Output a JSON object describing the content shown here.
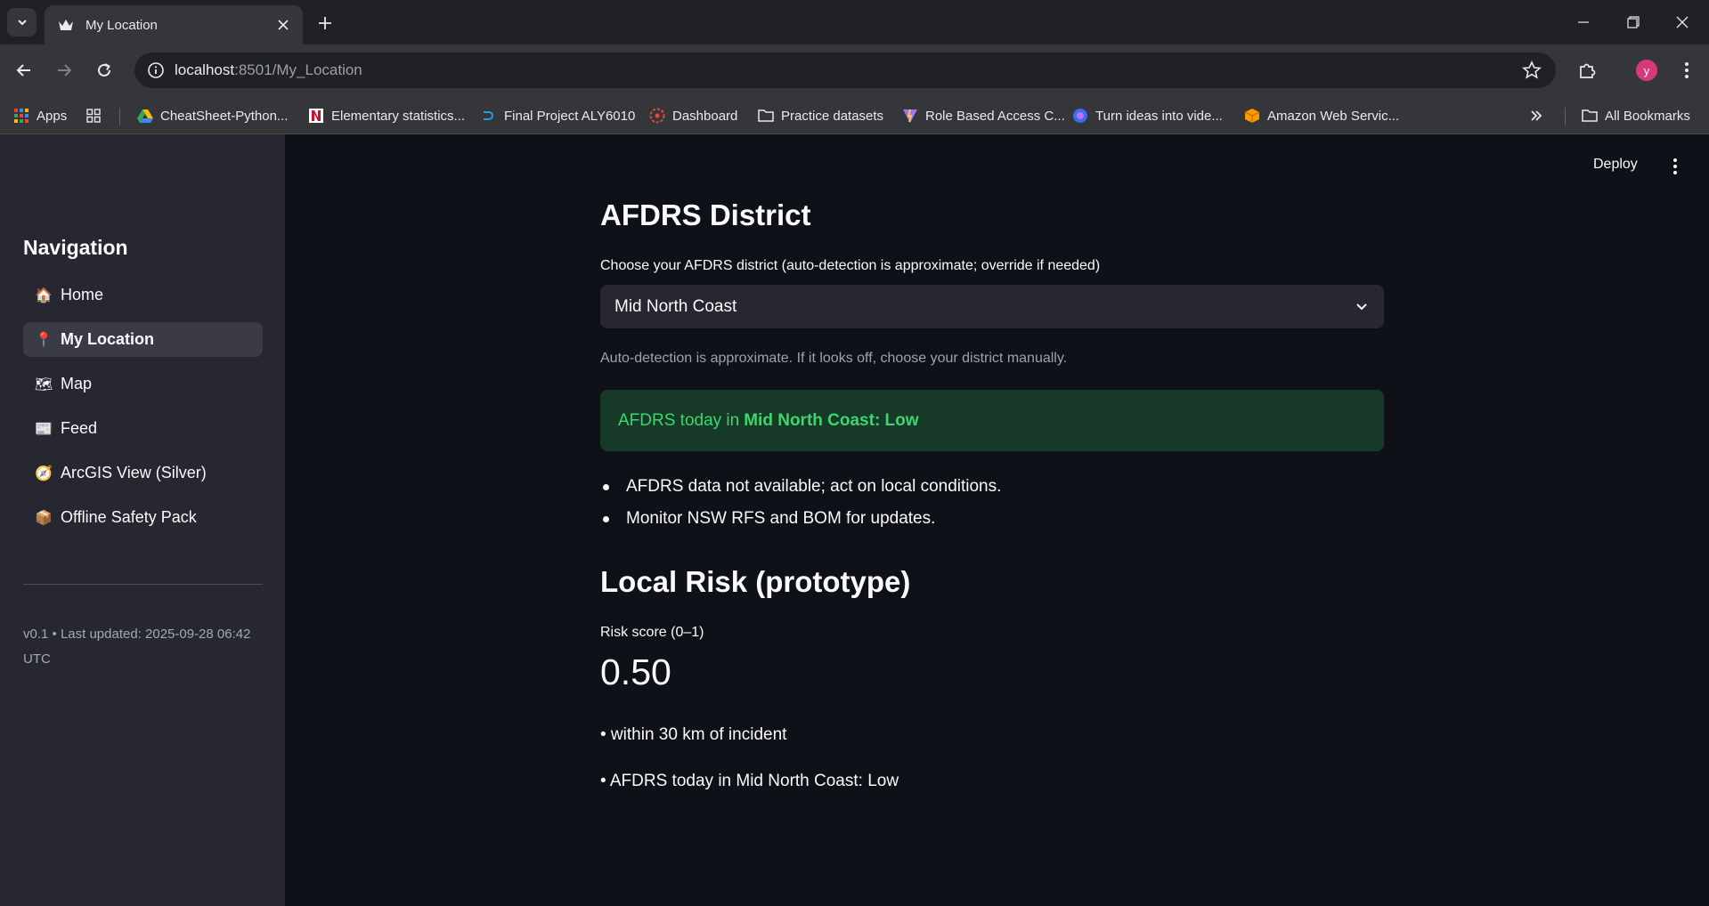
{
  "browser": {
    "tab_title": "My Location",
    "url_host": "localhost",
    "url_path": ":8501/My_Location",
    "avatar_letter": "y",
    "bookmarks": [
      {
        "label": "Apps",
        "icon": "apps-grid-icon"
      },
      {
        "label": "",
        "icon": "tab-groups-icon"
      },
      {
        "label": "CheatSheet-Python...",
        "icon": "google-drive-icon"
      },
      {
        "label": "Elementary statistics...",
        "icon": "netflix-n-icon"
      },
      {
        "label": "Final Project ALY6010",
        "icon": "d-logo-icon"
      },
      {
        "label": "Dashboard",
        "icon": "dashboard-icon"
      },
      {
        "label": "Practice datasets",
        "icon": "folder-icon"
      },
      {
        "label": "Role Based Access C...",
        "icon": "vite-icon"
      },
      {
        "label": "Turn ideas into vide...",
        "icon": "video-ai-icon"
      },
      {
        "label": "Amazon Web Servic...",
        "icon": "aws-cube-icon"
      }
    ],
    "all_bookmarks": "All Bookmarks"
  },
  "sidebar": {
    "title": "Navigation",
    "items": [
      {
        "emoji": "🏠",
        "label": "Home",
        "active": false
      },
      {
        "emoji": "📍",
        "label": "My Location",
        "active": true
      },
      {
        "emoji": "🗺",
        "label": "Map",
        "active": false
      },
      {
        "emoji": "📰",
        "label": "Feed",
        "active": false
      },
      {
        "emoji": "🧭",
        "label": "ArcGIS View (Silver)",
        "active": false
      },
      {
        "emoji": "📦",
        "label": "Offline Safety Pack",
        "active": false
      }
    ],
    "version_text": "v0.1 • Last updated: 2025-09-28 06:42 UTC"
  },
  "header": {
    "deploy_label": "Deploy"
  },
  "main": {
    "section1_title": "AFDRS District",
    "select_label": "Choose your AFDRS district (auto-detection is approximate; override if needed)",
    "select_value": "Mid North Coast",
    "caption": "Auto-detection is approximate. If it looks off, choose your district manually.",
    "alert_prefix": "AFDRS today in",
    "alert_strong": "Mid North Coast: Low",
    "bullets": [
      "AFDRS data not available; act on local conditions.",
      "Monitor NSW RFS and BOM for updates."
    ],
    "section2_title": "Local Risk (prototype)",
    "metric_label": "Risk score (0–1)",
    "metric_value": "0.50",
    "notes": [
      "• within 30 km of incident",
      "• AFDRS today in Mid North Coast: Low"
    ]
  },
  "colors": {
    "app_bg": "#0e1117",
    "sidebar_bg": "#262730",
    "success_bg": "#173928",
    "success_text": "#3dd56d"
  }
}
